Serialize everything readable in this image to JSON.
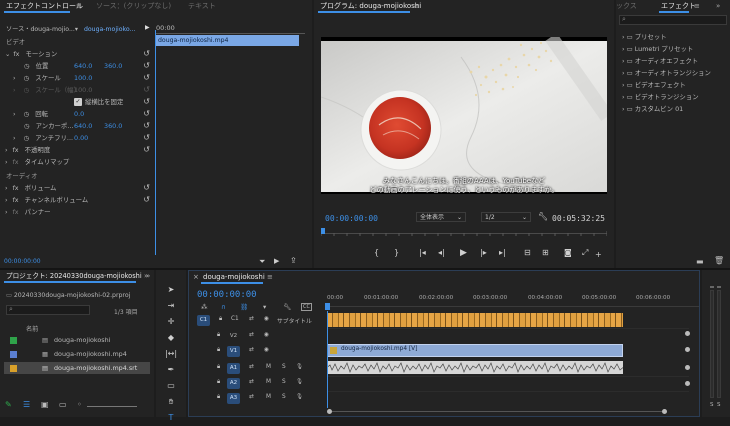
{
  "effect_controls": {
    "tabs": [
      "エフェクトコントロール",
      "ソース：(クリップなし)",
      "テキスト"
    ],
    "source_label": "ソース・douga-mojio...",
    "clip_label": "douga-mojioko...",
    "mini_timecode": "00:00",
    "clip_bar": "douga-mojiokoshi.mp4",
    "video_header": "ビデオ",
    "motion": "モーション",
    "position": {
      "label": "位置",
      "x": "640.0",
      "y": "360.0"
    },
    "scale": {
      "label": "スケール",
      "value": "100.0"
    },
    "scale_width": {
      "label": "スケール（幅）",
      "value": "100.0"
    },
    "uniform_scale": "縦横比を固定",
    "rotation": {
      "label": "回転",
      "value": "0.0"
    },
    "anchor": {
      "label": "アンカーポ...",
      "x": "640.0",
      "y": "360.0"
    },
    "antiflicker": {
      "label": "アンチフリ...",
      "value": "0.00"
    },
    "opacity": "不透明度",
    "time_remap": "タイムリマップ",
    "audio_header": "オーディオ",
    "volume": "ボリューム",
    "channel_volume": "チャンネルボリューム",
    "panner": "パンナー",
    "footer_timecode": "00:00:00:00"
  },
  "program": {
    "title": "プログラム: douga-mojiokoshi",
    "subtitle_line1": "みなさんこんにちは。番組のAAAは、YouTubeなど",
    "subtitle_line2": "どの動画のアレーションに使う、というものがありますか。",
    "timecode": "00:00:00:00",
    "fit": "全体表示",
    "resolution": "1/2",
    "duration": "00:05:32:25"
  },
  "effects": {
    "tabs": [
      "ックス",
      "エフェクト"
    ],
    "items": [
      "プリセット",
      "Lumetri プリセット",
      "オーディオエフェクト",
      "オーディオトランジション",
      "ビデオエフェクト",
      "ビデオトランジション",
      "カスタムビン 01"
    ]
  },
  "project": {
    "title": "プロジェクト: 20240330douga-mojiokoshi",
    "file": "20240330douga-mojiokoshi-02.prproj",
    "item_count": "1/3 項目",
    "col_name": "名前",
    "items": [
      {
        "name": "douga-mojiokoshi",
        "color": "#2fa34a"
      },
      {
        "name": "douga-mojiokoshi.mp4",
        "color": "#5b7fd1"
      },
      {
        "name": "douga-mojiokoshi.mp4.srt",
        "color": "#d8a02a"
      }
    ]
  },
  "timeline": {
    "tab": "douga-mojiokoshi",
    "timecode": "00:00:00:00",
    "ruler": [
      "00:00",
      "00:01:00:00",
      "00:02:00:00",
      "00:03:00:00",
      "00:04:00:00",
      "00:05:00:00",
      "00:06:00:00"
    ],
    "subtitle_track": "サブタイトル",
    "c1": "C1",
    "video_tracks": [
      "V2",
      "V1"
    ],
    "audio_tracks": [
      "A1",
      "A2",
      "A3"
    ],
    "video_clip": "douga-mojiokoshi.mp4 [V]",
    "m": "M",
    "s": "S"
  },
  "meters": {
    "labels": [
      "S",
      "S"
    ]
  }
}
